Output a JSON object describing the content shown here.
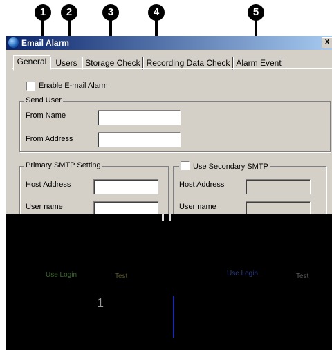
{
  "callouts": [
    "1",
    "2",
    "3",
    "4",
    "5"
  ],
  "window": {
    "title": "Email Alarm",
    "close_glyph": "X"
  },
  "tabs": [
    {
      "label": "General",
      "active": true
    },
    {
      "label": "Users",
      "active": false
    },
    {
      "label": "Storage Check",
      "active": false
    },
    {
      "label": "Recording Data Check",
      "active": false
    },
    {
      "label": "Alarm Event",
      "active": false
    }
  ],
  "general": {
    "enable_email_alarm": {
      "label": "Enable E-mail Alarm",
      "checked": false
    },
    "send_user": {
      "title": "Send User",
      "from_name_label": "From Name",
      "from_name_value": "",
      "from_address_label": "From Address",
      "from_address_value": ""
    },
    "primary_smtp": {
      "title": "Primary SMTP Setting",
      "host_label": "Host Address",
      "host_value": "",
      "user_label": "User name",
      "user_value": ""
    },
    "secondary_smtp": {
      "title": "Use Secondary SMTP",
      "checked": false,
      "host_label": "Host Address",
      "user_label": "User name"
    }
  },
  "occluded": {
    "left_login": "Use Login",
    "left_test": "Test",
    "right_login": "Use Login",
    "right_test": "Test",
    "digit": "1"
  }
}
